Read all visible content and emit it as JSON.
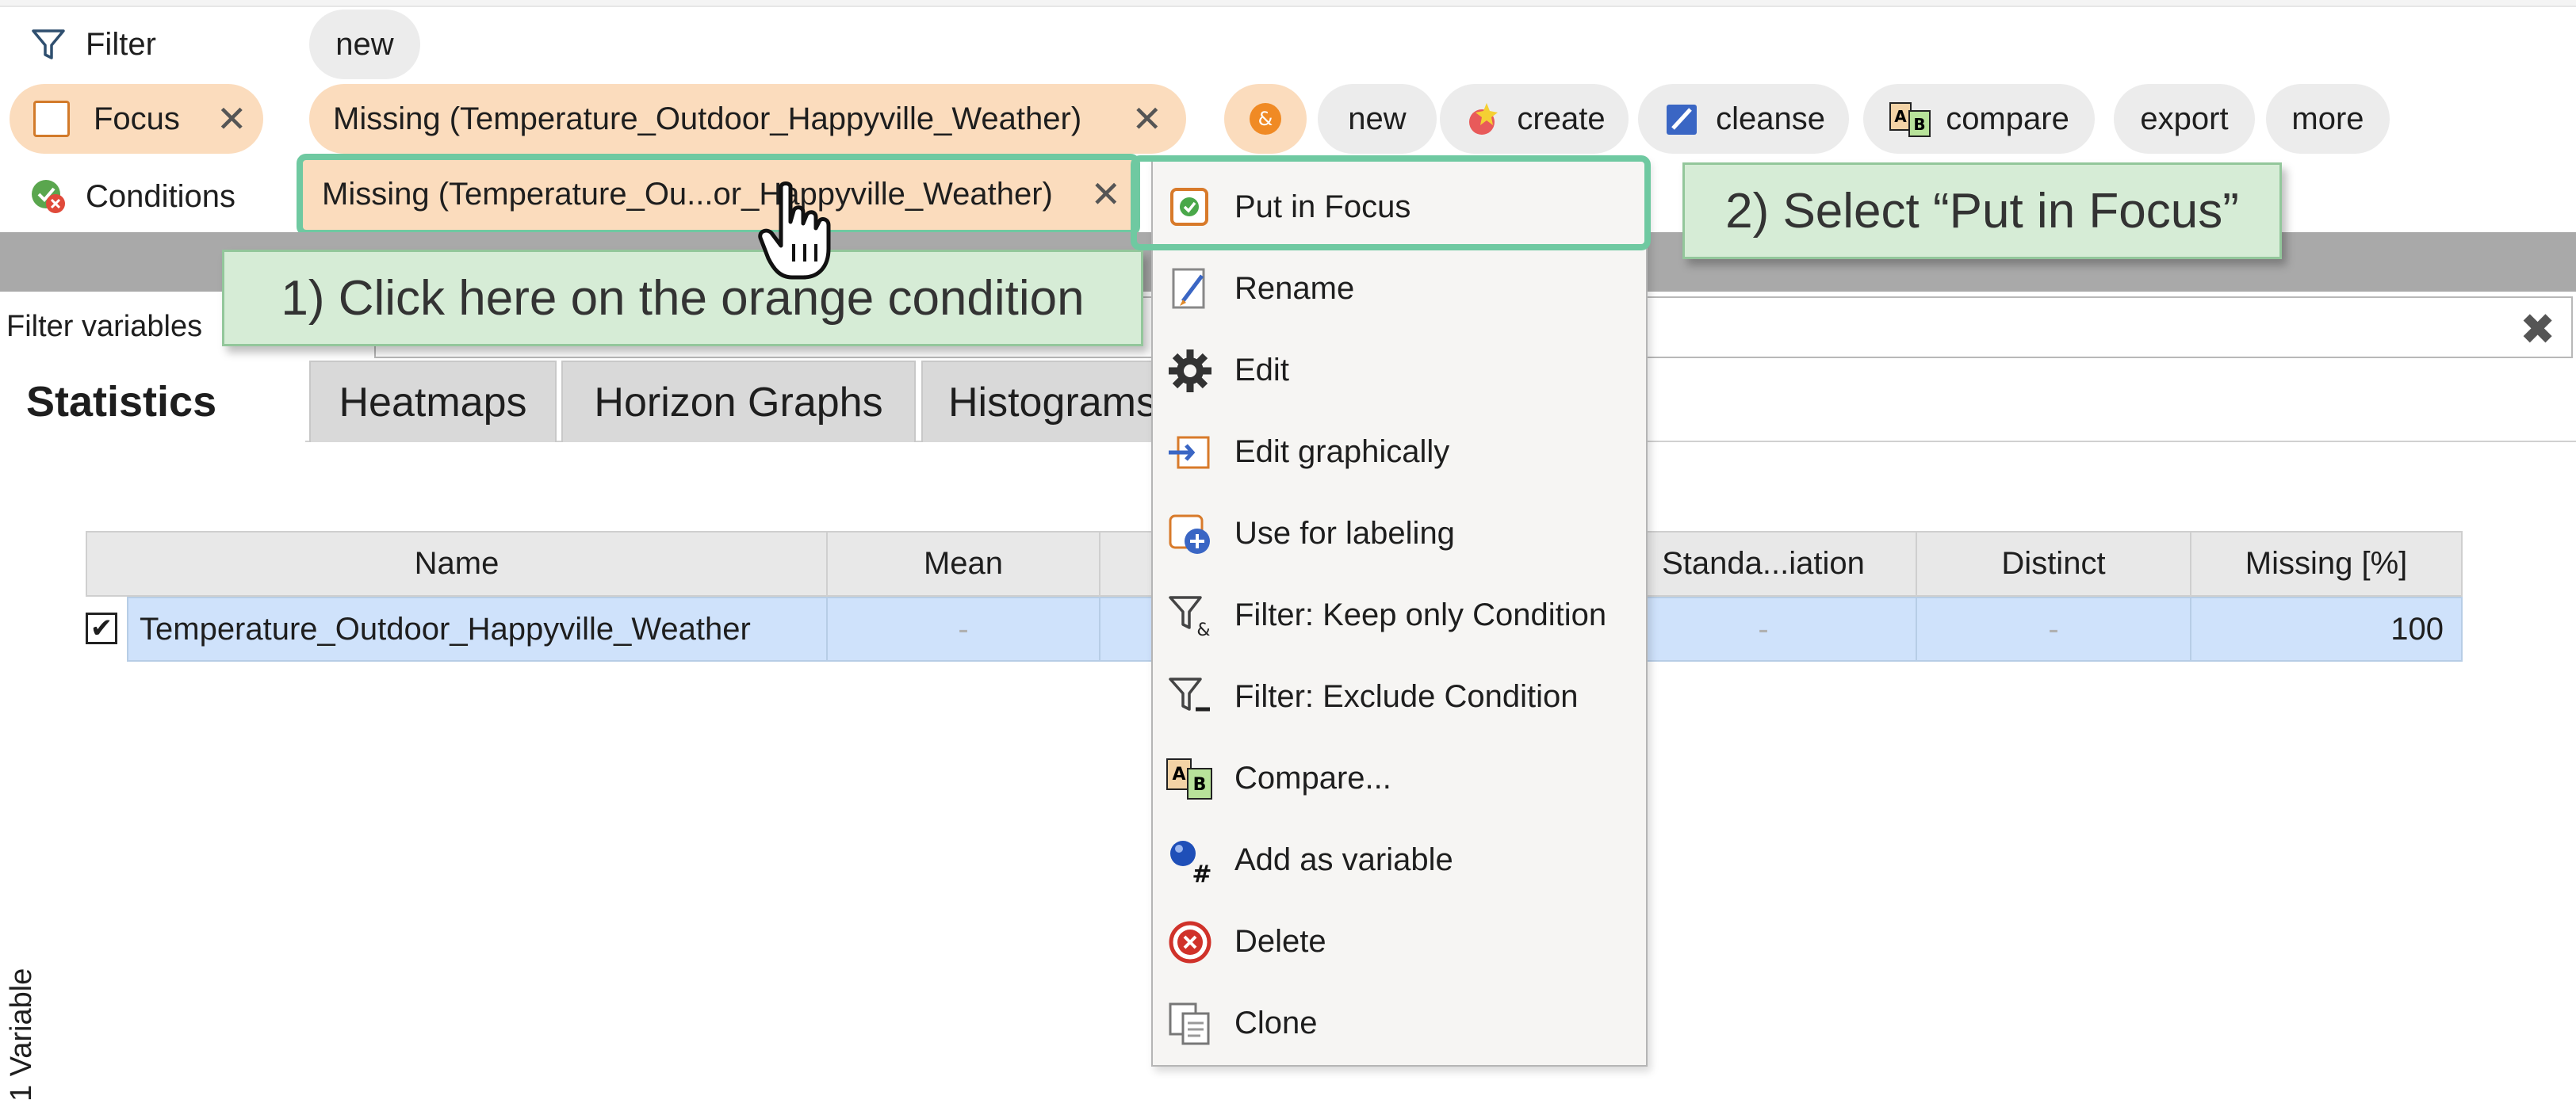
{
  "filter_row": {
    "label": "Filter",
    "chip": "new"
  },
  "focus_row": {
    "label": "Focus",
    "chip": "Missing (Temperature_Outdoor_Happyville_Weather)",
    "toolbar": [
      "new",
      "create",
      "cleanse",
      "compare",
      "export",
      "more"
    ]
  },
  "conditions_row": {
    "label": "Conditions",
    "chip": "Missing (Temperature_Ou...or_Happyville_Weather)"
  },
  "filter_variables": {
    "label": "Filter variables",
    "value": ""
  },
  "tabs": [
    "Statistics",
    "Heatmaps",
    "Horizon Graphs",
    "Histograms"
  ],
  "table": {
    "columns": [
      "Name",
      "Mean",
      "",
      "Standa...iation",
      "Distinct",
      "Missing [%]"
    ],
    "rows": [
      {
        "checked": true,
        "name": "Temperature_Outdoor_Happyville_Weather",
        "mean": "-",
        "std": "-",
        "distinct": "-",
        "missing": "100"
      }
    ]
  },
  "side_label": "1 Variable",
  "context_menu": {
    "items": [
      {
        "label": "Put in Focus",
        "icon": "focus-check-icon"
      },
      {
        "label": "Rename",
        "icon": "rename-icon"
      },
      {
        "label": "Edit",
        "icon": "gear-icon"
      },
      {
        "label": "Edit graphically",
        "icon": "edit-graphically-icon"
      },
      {
        "label": "Use for labeling",
        "icon": "labeling-icon"
      },
      {
        "label": "Filter: Keep only Condition",
        "icon": "filter-keep-icon"
      },
      {
        "label": "Filter: Exclude Condition",
        "icon": "filter-exclude-icon"
      },
      {
        "label": "Compare...",
        "icon": "compare-icon"
      },
      {
        "label": "Add as variable",
        "icon": "add-variable-icon"
      },
      {
        "label": "Delete",
        "icon": "delete-icon"
      },
      {
        "label": "Clone",
        "icon": "clone-icon"
      }
    ]
  },
  "callouts": {
    "step1": "1) Click here on the orange condition",
    "step2": "2) Select “Put in Focus”"
  },
  "colors": {
    "orange_chip": "#fbdcbd",
    "grey_chip": "#ececec",
    "highlight": "#6fc9a1",
    "callout_bg": "#d6ecd6",
    "selected_row": "#cfe2fb"
  }
}
